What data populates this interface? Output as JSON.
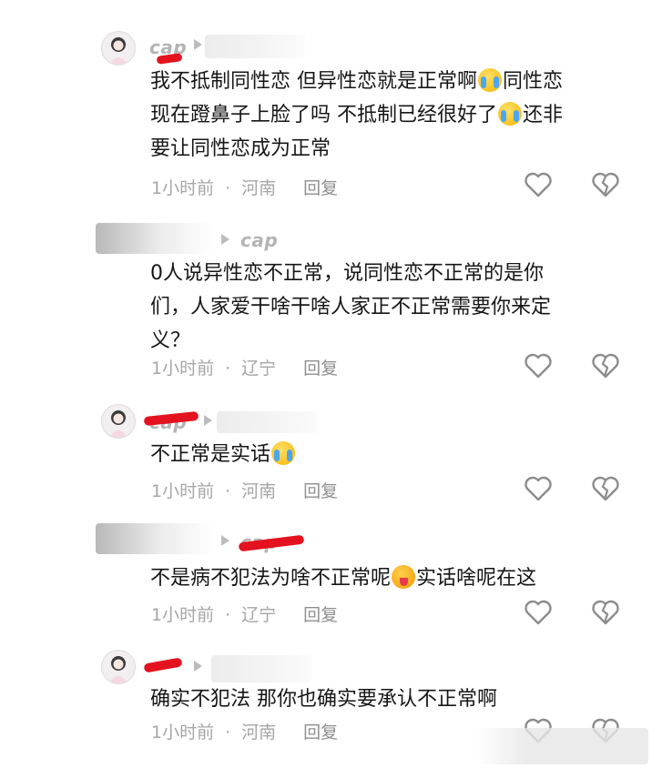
{
  "comments": [
    {
      "username": "cap",
      "text_lines": [
        "我不抵制同性恋 但异性恋就是正常啊",
        "同性恋",
        "现在蹬鼻子上脸了吗 不抵制已经很好了",
        "还非",
        "要让同性恋成为正常"
      ],
      "time": "1小时前",
      "location": "河南",
      "reply_label": "回复"
    },
    {
      "username": "cap",
      "text_lines": [
        "0人说异性恋不正常，说同性恋不正常的是你",
        "们，人家爱干啥干啥人家正不正常需要你来定",
        "义？"
      ],
      "time": "1小时前",
      "location": "辽宁",
      "reply_label": "回复"
    },
    {
      "username": "cap",
      "text_lines": [
        "不正常是实话"
      ],
      "time": "1小时前",
      "location": "河南",
      "reply_label": "回复"
    },
    {
      "username": "cap",
      "text_lines": [
        "不是病不犯法为啥不正常呢",
        "实话啥呢在这"
      ],
      "time": "1小时前",
      "location": "辽宁",
      "reply_label": "回复"
    },
    {
      "username": "",
      "text_lines": [
        "确实不犯法 那你也确实要承认不正常啊"
      ],
      "time": "1小时前",
      "location": "河南",
      "reply_label": "回复"
    }
  ],
  "icons": {
    "like": "heart-outline-icon",
    "dislike": "broken-heart-icon",
    "reply_indicator": "play-triangle-icon"
  },
  "colors": {
    "redaction": "#e4121e",
    "meta_text": "#a6a6a6",
    "body_text": "#161616"
  }
}
